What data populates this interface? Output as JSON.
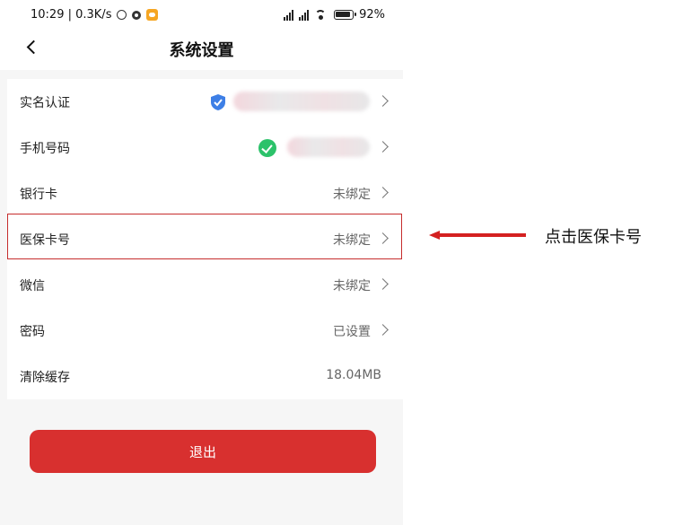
{
  "statusbar": {
    "time_speed": "10:29 | 0.3K/s",
    "battery": "92%"
  },
  "header": {
    "title": "系统设置"
  },
  "rows": [
    {
      "label": "实名认证"
    },
    {
      "label": "手机号码"
    },
    {
      "label": "银行卡",
      "value": "未绑定"
    },
    {
      "label": "医保卡号",
      "value": "未绑定"
    },
    {
      "label": "微信",
      "value": "未绑定"
    },
    {
      "label": "密码",
      "value": "已设置"
    },
    {
      "label": "清除缓存",
      "value": "18.04MB"
    }
  ],
  "logout": {
    "label": "退出"
  },
  "annotation": {
    "text": "点击医保卡号"
  },
  "colors": {
    "accent": "#d8302f",
    "highlight": "#c62d2d",
    "check": "#2cc26a",
    "shield": "#3d7fe6"
  }
}
